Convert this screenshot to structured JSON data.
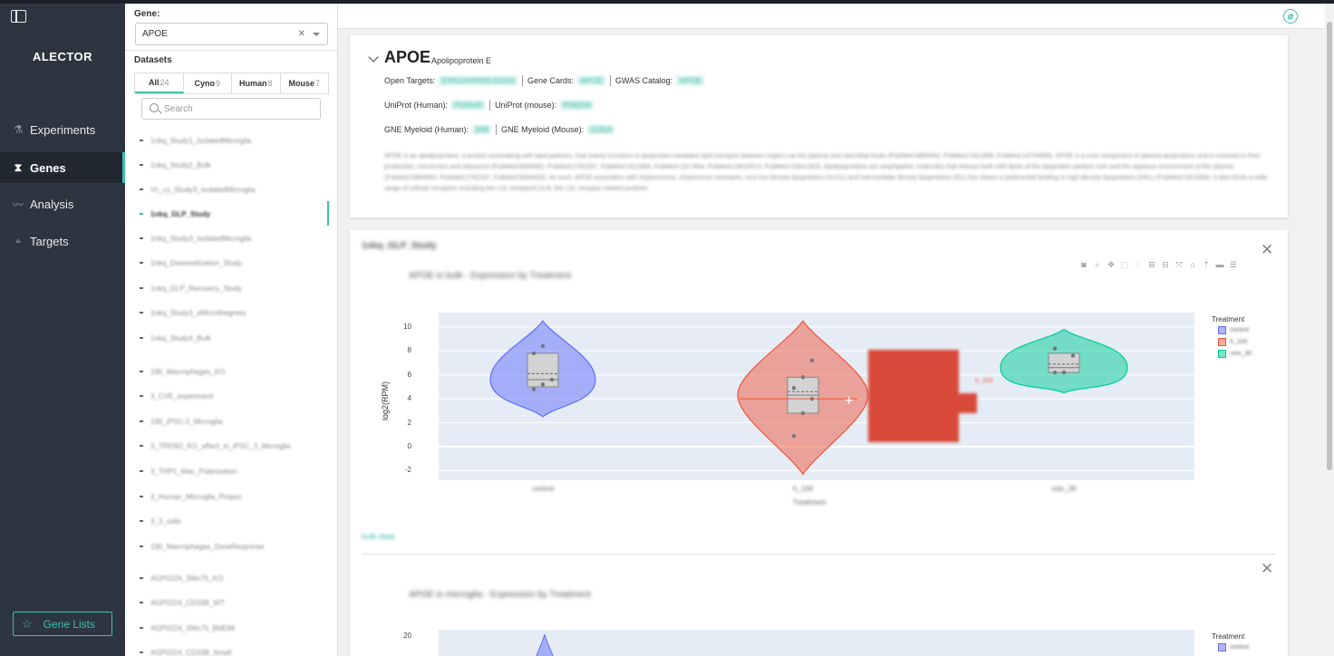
{
  "nav": {
    "brand": "ALECTOR",
    "items": [
      {
        "label": "Experiments",
        "icon": "flask-icon"
      },
      {
        "label": "Genes",
        "icon": "dna-icon",
        "active": true
      },
      {
        "label": "Analysis",
        "icon": "chart-line-icon"
      },
      {
        "label": "Targets",
        "icon": "target-icon"
      }
    ],
    "gene_lists": "Gene Lists"
  },
  "panel": {
    "gene_label": "Gene:",
    "gene_value": "APOE",
    "datasets_label": "Datasets",
    "tabs": [
      {
        "label": "All",
        "count": "24",
        "active": true
      },
      {
        "label": "Cyno",
        "count": "9"
      },
      {
        "label": "Human",
        "count": "8"
      },
      {
        "label": "Mouse",
        "count": "7"
      }
    ],
    "search_placeholder": "Search",
    "datasets": [
      "1nkq_Study1_IsolatedMicroglia",
      "1nkq_Study2_Bulk",
      "Vc_cy_Study3_IsolatedMicroglia",
      "1nkq_GLP_Study",
      "1nkq_Study3_IsolatedMicroglia",
      "1nkq_Desensitization_Study",
      "1nkq_GLP_Recovery_Study",
      "1nkq_Study3_sMicrothegress",
      "1nkq_Study4_Bulk",
      "190_Macrophages_KO",
      "3_CVE_experiment",
      "190_iPSC-2_Microglia",
      "3_TREM2_KO_effect_in_iPSC_3_Microglia",
      "3_THP1_Mac_Polarization",
      "3_Human_Microglia_Project",
      "3_3_cells",
      "190_Macrophages_DoseResponse",
      "AGP0224_SMx75_KO",
      "AGP0224_CD33B_WT",
      "AGP0224_SMx75_BMDM",
      "AGP0224_CD33B_Small"
    ]
  },
  "gene": {
    "symbol": "APOE",
    "full_name": "Apolipoprotein E",
    "open_targets_label": "Open Targets:",
    "open_targets_value": "ENSG00000130203",
    "gene_cards_label": "Gene Cards:",
    "gene_cards_value": "APOE",
    "gwas_label": "GWAS Catalog:",
    "gwas_value": "APOE",
    "uniprot_human_label": "UniProt (Human):",
    "uniprot_human_value": "P02649",
    "uniprot_mouse_label": "UniProt (mouse):",
    "uniprot_mouse_value": "P08226",
    "gne_human_label": "GNE Myeloid (Human):",
    "gne_human_value": "348",
    "gne_mouse_label": "GNE Myeloid (Mouse):",
    "gne_mouse_value": "11816",
    "description": "APOE is an apolipoprotein, a protein associating with lipid particles, that mainly functions in lipoprotein-mediated lipid transport between organs via the plasma and interstitial fluids (PubMed:6860692, PubMed:1911868, PubMed:14754908). APOE is a core component of plasma lipoproteins and is involved in their production, conversion and clearance (PubMed:6860692, PubMed:2762297, PubMed:1911868, PubMed:1917954, PubMed:23620513, PubMed:25641363). Apolipoproteins are amphipathic molecules that interact both with lipids of the lipoprotein particle core and the aqueous environment of the plasma (PubMed:6860692, PubMed:2762297, PubMed:9395455). As such, APOE associates with chylomicrons, chylomicron remnants, very low density lipoproteins (VLDL) and intermediate density lipoproteins (IDL) but shows a preferential binding to high-density lipoproteins (HDL) (PubMed:1911868). It also binds a wide range of cellular receptors including the LDL receptor/LDLR, the LDL receptor-related proteins."
  },
  "plot1": {
    "study": "1nkq_GLP_Study",
    "title": "APOE in bulk - Expression by Treatment",
    "link": "bulk data",
    "legend_title": "Treatment",
    "hover_note": "h_100"
  },
  "plot2": {
    "title": "APOE in microglia - Expression by Treatment",
    "legend_title": "Treatment"
  },
  "chart_data": [
    {
      "type": "violin",
      "title": "APOE in bulk - Expression by Treatment",
      "xlabel": "Treatment",
      "ylabel": "log2(RPM)",
      "ylim": [
        -2.8,
        11.2
      ],
      "yticks": [
        -2,
        0,
        2,
        4,
        6,
        8,
        10
      ],
      "categories": [
        "control",
        "h_100",
        "vstx_30"
      ],
      "series": [
        {
          "name": "control",
          "color": "#636efa",
          "min": 2.5,
          "max": 10.5,
          "q1": 5.0,
          "median": 5.6,
          "q3": 7.8,
          "mean": 6.1,
          "points": [
            4.8,
            5.2,
            5.6,
            7.8,
            8.4
          ]
        },
        {
          "name": "h_100",
          "color": "#ef553b",
          "min": -2.3,
          "max": 10.5,
          "q1": 2.8,
          "median": 4.3,
          "q3": 5.8,
          "mean": 4.6,
          "points": [
            0.9,
            2.8,
            4.0,
            4.9,
            5.8,
            7.2
          ]
        },
        {
          "name": "vstx_30",
          "color": "#00cc96",
          "min": 4.5,
          "max": 9.8,
          "q1": 6.2,
          "median": 6.6,
          "q3": 7.8,
          "mean": 6.9,
          "points": [
            6.2,
            6.2,
            7.6,
            8.2
          ]
        }
      ]
    },
    {
      "type": "violin",
      "title": "APOE in microglia - Expression by Treatment",
      "ytick_visible": [
        20
      ],
      "series": []
    }
  ]
}
